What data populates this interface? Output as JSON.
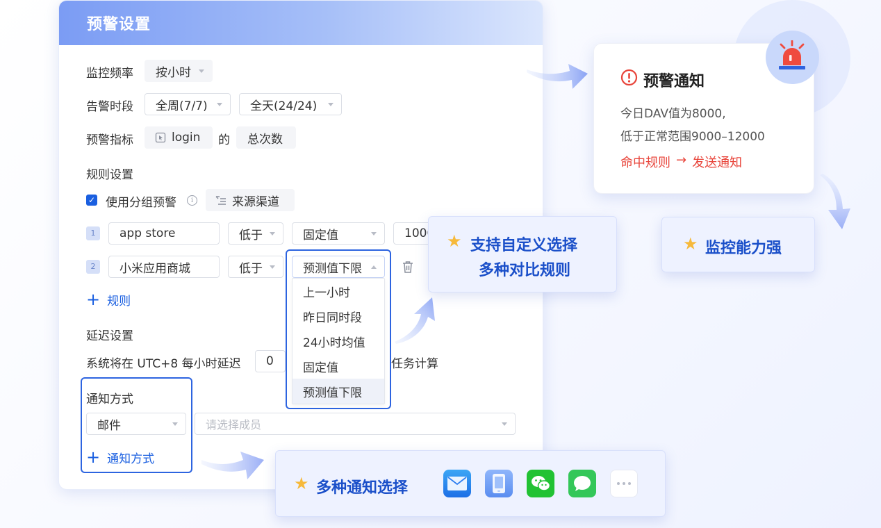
{
  "panel": {
    "title": "预警设置"
  },
  "monitor": {
    "label": "监控频率",
    "value": "按小时"
  },
  "alert_period": {
    "label": "告警时段",
    "week_value": "全周(7/7)",
    "day_value": "全天(24/24)"
  },
  "metric": {
    "label": "预警指标",
    "event": "login",
    "connector": "的",
    "measure": "总次数"
  },
  "rules": {
    "label": "规则设置",
    "group_label": "使用分组预警",
    "group_by": "来源渠道",
    "items": [
      {
        "index": "1",
        "channel": "app store",
        "compare": "低于",
        "type": "固定值",
        "value": "1000"
      },
      {
        "index": "2",
        "channel": "小米应用商城",
        "compare": "低于",
        "type": "预测值下限"
      }
    ],
    "add_label": "规则",
    "dropdown_options": [
      "上一小时",
      "昨日同时段",
      "24小时均值",
      "固定值",
      "预测值下限"
    ],
    "dropdown_selected": "预测值下限"
  },
  "delay": {
    "label": "延迟设置",
    "text_before": "系统将在 UTC+8 每小时延迟",
    "value": "0",
    "text_after": "任务计算"
  },
  "notify": {
    "label": "通知方式",
    "method": "邮件",
    "member_placeholder": "请选择成员",
    "add_label": "通知方式"
  },
  "alert_card": {
    "title": "预警通知",
    "line1": "今日DAV值为8000,",
    "line2": "低于正常范围9000–12000",
    "rule_hit": "命中规则",
    "arrow": "→",
    "send": "发送通知"
  },
  "callouts": {
    "custom_line1": "支持自定义选择",
    "custom_line2": "多种对比规则",
    "monitor": "监控能力强",
    "multi_notify": "多种通知选择"
  },
  "icons": [
    "mail-icon",
    "phone-icon",
    "wechat-icon",
    "message-icon",
    "more-icon"
  ],
  "colors": {
    "primary": "#1a5fe0",
    "accent_red": "#e8443a",
    "star": "#f6b93b"
  }
}
